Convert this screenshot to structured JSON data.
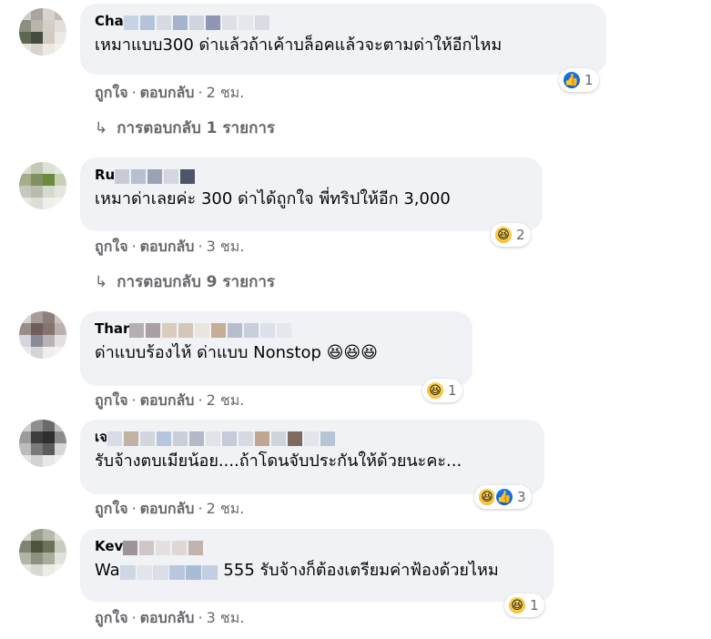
{
  "comments": [
    {
      "author": "Cha",
      "text": "เหมาแบบ300 ด่าแล้วถ้าเค้าบล็อคแล้วจะตามด่าให้อีกไหม",
      "reactions": [
        "like"
      ],
      "reaction_count": "1",
      "like": "ถูกใจ",
      "reply": "ตอบกลับ",
      "time": "2 ชม.",
      "replies_label": "การตอบกลับ 1 รายการ"
    },
    {
      "author": "Ru",
      "text": "เหมาด่าเลยค่ะ 300 ด่าได้ถูกใจ พี่ทริปให้อีก 3,000",
      "reactions": [
        "haha"
      ],
      "reaction_count": "2",
      "like": "ถูกใจ",
      "reply": "ตอบกลับ",
      "time": "3 ชม.",
      "replies_label": "การตอบกลับ 9 รายการ"
    },
    {
      "author": "Thar",
      "text": "ด่าแบบร้องไห้ ด่าแบบ Nonstop 😆😆😆",
      "reactions": [
        "haha"
      ],
      "reaction_count": "1",
      "like": "ถูกใจ",
      "reply": "ตอบกลับ",
      "time": "2 ชม."
    },
    {
      "author": "เจ",
      "text": "รับจ้างตบเมียน้อย....ถ้าโดนจับประกันให้ด้วยนะคะ...",
      "reactions": [
        "haha",
        "like"
      ],
      "reaction_count": "3",
      "like": "ถูกใจ",
      "reply": "ตอบกลับ",
      "time": "2 ชม."
    },
    {
      "author": "Kev",
      "text_prefix": "Wa",
      "text": "555 รับจ้างก็ต้องเตรียมค่าฟ้องด้วยไหม",
      "reactions": [
        "haha"
      ],
      "reaction_count": "1",
      "like": "ถูกใจ",
      "reply": "ตอบกลับ",
      "time": "3 ชม."
    }
  ],
  "icons": {
    "like": "thumbs-up-icon",
    "haha": "laughing-face-icon",
    "reply_arrow": "reply-arrow-icon"
  },
  "colors": {
    "bubble": "#f0f2f5",
    "meta_text": "#65676b",
    "like_blue": "#1877f2",
    "haha_yellow": "#f7b125"
  }
}
